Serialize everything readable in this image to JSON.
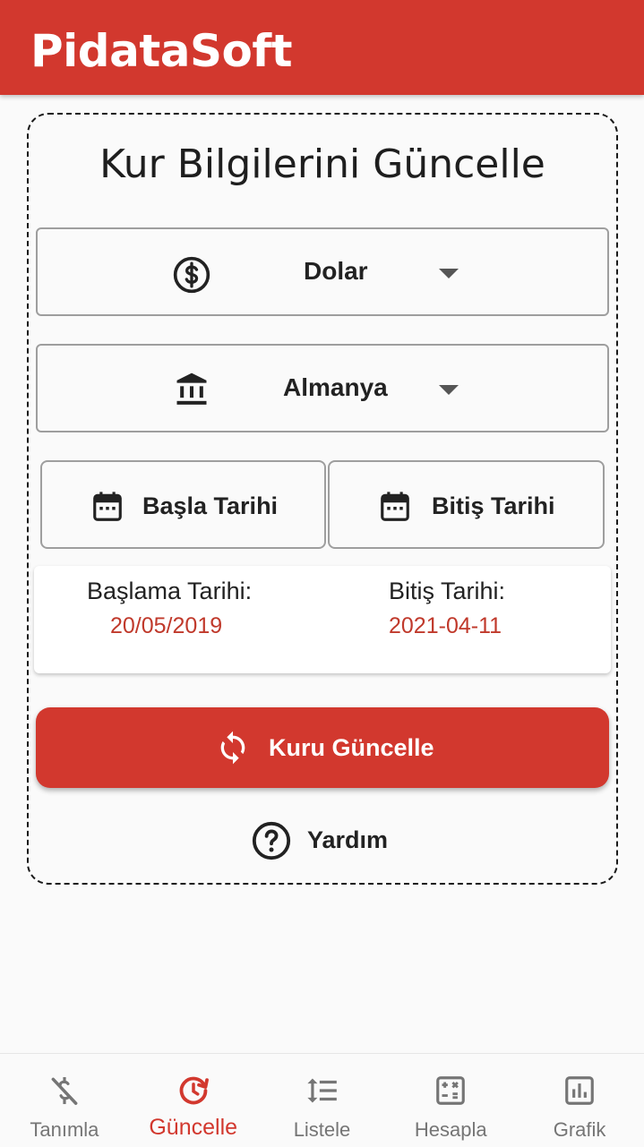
{
  "app": {
    "title": "PidataSoft"
  },
  "page": {
    "title": "Kur Bilgilerini Güncelle"
  },
  "currency_select": {
    "value": "Dolar",
    "icon": "dollar-circle-icon"
  },
  "country_select": {
    "value": "Almanya",
    "icon": "bank-icon"
  },
  "date_buttons": {
    "start_label": "Başla Tarihi",
    "end_label": "Bitiş Tarihi",
    "icon": "calendar-icon"
  },
  "dates": {
    "start_label": "Başlama Tarihi:",
    "start_value": "20/05/2019",
    "end_label": "Bitiş Tarihi:",
    "end_value": "2021-04-11"
  },
  "update_button": {
    "label": "Kuru Güncelle",
    "icon": "refresh-icon"
  },
  "help": {
    "label": "Yardım",
    "icon": "help-circle-icon"
  },
  "bottom_nav": {
    "items": [
      {
        "label": "Tanımla",
        "icon": "money-off-icon",
        "active": false
      },
      {
        "label": "Güncelle",
        "icon": "history-icon",
        "active": true
      },
      {
        "label": "Listele",
        "icon": "format-line-spacing-icon",
        "active": false
      },
      {
        "label": "Hesapla",
        "icon": "calculator-icon",
        "active": false
      },
      {
        "label": "Grafik",
        "icon": "bar-chart-icon",
        "active": false
      }
    ]
  },
  "colors": {
    "primary": "#d2382e",
    "date_value": "#c0392b",
    "nav_inactive": "#757575"
  }
}
